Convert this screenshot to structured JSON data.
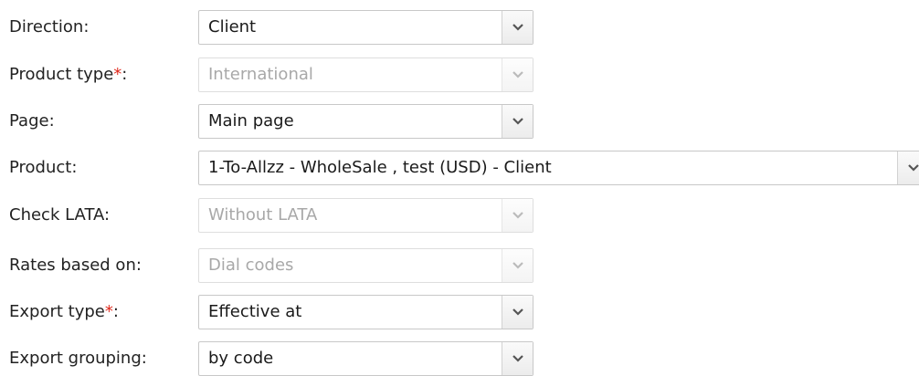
{
  "fields": {
    "direction": {
      "label": "Direction:",
      "value": "Client"
    },
    "product_type": {
      "label": "Product type",
      "required_mark": "*",
      "suffix": ":",
      "value": "International"
    },
    "page": {
      "label": "Page:",
      "value": "Main page"
    },
    "product": {
      "label": "Product:",
      "value": "1-To-Allzz - WholeSale , test (USD) - Client"
    },
    "check_lata": {
      "label": "Check LATA:",
      "value": "Without LATA"
    },
    "rates_based_on": {
      "label": "Rates based on:",
      "value": "Dial codes"
    },
    "export_type": {
      "label": "Export type",
      "required_mark": "*",
      "suffix": ":",
      "value": "Effective at"
    },
    "export_grouping": {
      "label": "Export grouping:",
      "value": "by code"
    }
  },
  "colors": {
    "required": "#e0281b",
    "disabled_text": "#a8a8a8",
    "border": "#c8c8c8"
  },
  "icons": {
    "dropdown": "chevron-down-icon"
  }
}
